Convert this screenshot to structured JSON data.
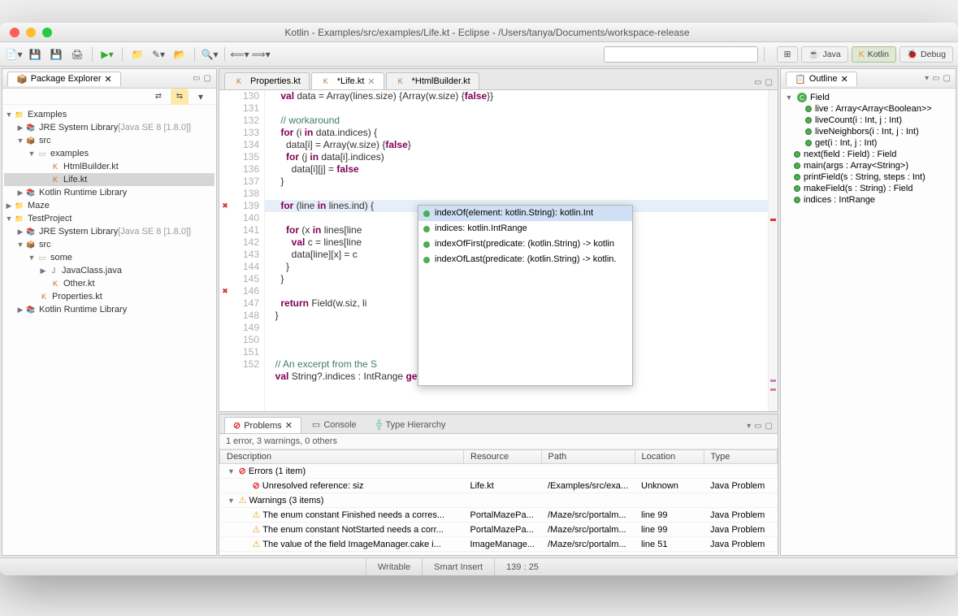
{
  "window": {
    "title": "Kotlin - Examples/src/examples/Life.kt - Eclipse - /Users/tanya/Documents/workspace-release"
  },
  "perspectives": {
    "java": "Java",
    "kotlin": "Kotlin",
    "debug": "Debug"
  },
  "packageExplorer": {
    "title": "Package Explorer",
    "items": {
      "examples": "Examples",
      "jre1": "JRE System Library",
      "jre1ver": "[Java SE 8 [1.8.0]]",
      "src1": "src",
      "pkg_examples": "examples",
      "htmlbuilder": "HtmlBuilder.kt",
      "life": "Life.kt",
      "kotlinrt1": "Kotlin Runtime Library",
      "maze": "Maze",
      "testproject": "TestProject",
      "jre2": "JRE System Library",
      "jre2ver": "[Java SE 8 [1.8.0]]",
      "src2": "src",
      "pkg_some": "some",
      "javaclass": "JavaClass.java",
      "other": "Other.kt",
      "properties": "Properties.kt",
      "kotlinrt2": "Kotlin Runtime Library"
    }
  },
  "editorTabs": {
    "properties": "Properties.kt",
    "life": "*Life.kt",
    "htmlbuilder": "*HtmlBuilder.kt"
  },
  "code": {
    "l130": "    val data = Array(lines.size) {Array(w.size) {false}}",
    "l131": "",
    "l132": "    // workaround",
    "l133": "    for (i in data.indices) {",
    "l134": "      data[i] = Array(w.size) {false}",
    "l135": "      for (j in data[i].indices)",
    "l136": "        data[i][j] = false",
    "l137": "    }",
    "l138": "",
    "l139": "    for (line in lines.ind) {",
    "l140": "      for (x in lines[line",
    "l141": "        val c = lines[line",
    "l142": "        data[line][x] = c ",
    "l143": "      }",
    "l144": "    }",
    "l145": "",
    "l146": "    return Field(w.siz, li",
    "l147": "  }",
    "l148": "",
    "l149": "",
    "l150": "",
    "l151": "  // An excerpt from the S",
    "l152": "  val String?.indices : IntRange get() = IntRange(0, this!!.size"
  },
  "lineNums": [
    "130",
    "131",
    "132",
    "133",
    "134",
    "135",
    "136",
    "137",
    "138",
    "139",
    "140",
    "141",
    "142",
    "143",
    "144",
    "145",
    "146",
    "147",
    "148",
    "149",
    "150",
    "151",
    "152"
  ],
  "completion": {
    "i0": "indexOf(element: kotlin.String): kotlin.Int",
    "i1": "indices: kotlin.IntRange",
    "i2": "indexOfFirst(predicate: (kotlin.String) -> kotlin",
    "i3": "indexOfLast(predicate: (kotlin.String) -> kotlin."
  },
  "outline": {
    "title": "Outline",
    "root": "Field",
    "m0": "live : Array<Array<Boolean>>",
    "m1": "liveCount(i : Int, j : Int)",
    "m2": "liveNeighbors(i : Int, j : Int)",
    "m3": "get(i : Int, j : Int)",
    "m4": "next(field : Field) : Field",
    "m5": "main(args : Array<String>)",
    "m6": "printField(s : String, steps : Int)",
    "m7": "makeField(s : String) : Field",
    "m8": "indices : IntRange"
  },
  "problems": {
    "tab_problems": "Problems",
    "tab_console": "Console",
    "tab_typeh": "Type Hierarchy",
    "summary": "1 error, 3 warnings, 0 others",
    "cols": {
      "desc": "Description",
      "res": "Resource",
      "path": "Path",
      "loc": "Location",
      "type": "Type"
    },
    "groups": {
      "errors": "Errors (1 item)",
      "warnings": "Warnings (3 items)"
    },
    "rows": {
      "e0": {
        "desc": "Unresolved reference: siz",
        "res": "Life.kt",
        "path": "/Examples/src/exa...",
        "loc": "Unknown",
        "type": "Java Problem"
      },
      "w0": {
        "desc": "The enum constant Finished needs a corres...",
        "res": "PortalMazePa...",
        "path": "/Maze/src/portalm...",
        "loc": "line 99",
        "type": "Java Problem"
      },
      "w1": {
        "desc": "The enum constant NotStarted needs a corr...",
        "res": "PortalMazePa...",
        "path": "/Maze/src/portalm...",
        "loc": "line 99",
        "type": "Java Problem"
      },
      "w2": {
        "desc": "The value of the field ImageManager.cake i...",
        "res": "ImageManage...",
        "path": "/Maze/src/portalm...",
        "loc": "line 51",
        "type": "Java Problem"
      }
    }
  },
  "status": {
    "writable": "Writable",
    "insert": "Smart Insert",
    "pos": "139 : 25"
  }
}
